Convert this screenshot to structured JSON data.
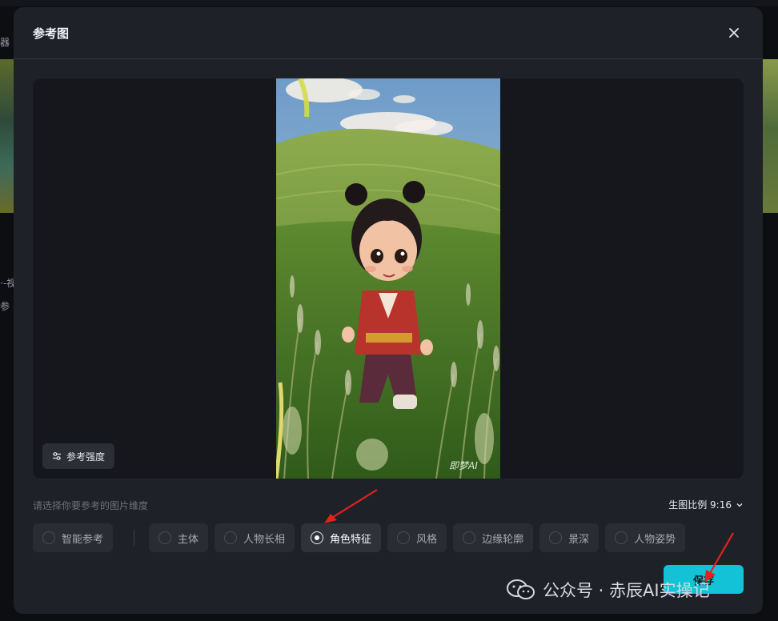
{
  "background": {
    "frag_top": "器",
    "frag_mid1": "·-视",
    "frag_mid2": "参"
  },
  "modal": {
    "title": "参考图",
    "close_icon": "close-icon",
    "image_watermark": "即梦AI",
    "strength_button": "参考强度",
    "hint": "请选择你要参考的图片维度",
    "ratio_label": "生图比例 9:16",
    "options": [
      {
        "label": "智能参考",
        "selected": false
      },
      {
        "label": "主体",
        "selected": false
      },
      {
        "label": "人物长相",
        "selected": false
      },
      {
        "label": "角色特征",
        "selected": true
      },
      {
        "label": "风格",
        "selected": false
      },
      {
        "label": "边缘轮廓",
        "selected": false
      },
      {
        "label": "景深",
        "selected": false
      },
      {
        "label": "人物姿势",
        "selected": false
      }
    ],
    "save_button": "保存"
  },
  "watermark": {
    "text": "公众号 · 赤辰AI实操记"
  },
  "colors": {
    "accent": "#13c2d6",
    "annotation_arrow": "#e0231b"
  }
}
